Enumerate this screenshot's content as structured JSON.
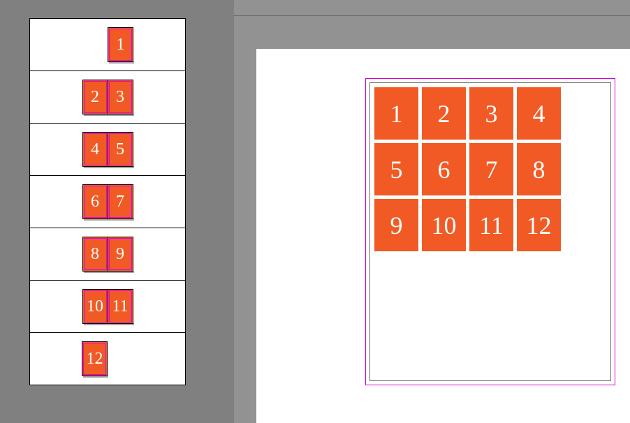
{
  "colors": {
    "page_fill": "#f15a24",
    "page_text": "#ffffff",
    "canvas_bg": "#929292",
    "app_bg": "#808080",
    "margin_guide": "#d400d4"
  },
  "thumbs": {
    "spreads": [
      {
        "pages": [
          "1"
        ],
        "kind": "first"
      },
      {
        "pages": [
          "2",
          "3"
        ],
        "kind": "pair"
      },
      {
        "pages": [
          "4",
          "5"
        ],
        "kind": "pair"
      },
      {
        "pages": [
          "6",
          "7"
        ],
        "kind": "pair"
      },
      {
        "pages": [
          "8",
          "9"
        ],
        "kind": "pair"
      },
      {
        "pages": [
          "10",
          "11"
        ],
        "kind": "pair"
      },
      {
        "pages": [
          "12"
        ],
        "kind": "last"
      }
    ]
  },
  "layout": {
    "cells": [
      "1",
      "2",
      "3",
      "4",
      "5",
      "6",
      "7",
      "8",
      "9",
      "10",
      "11",
      "12"
    ]
  }
}
